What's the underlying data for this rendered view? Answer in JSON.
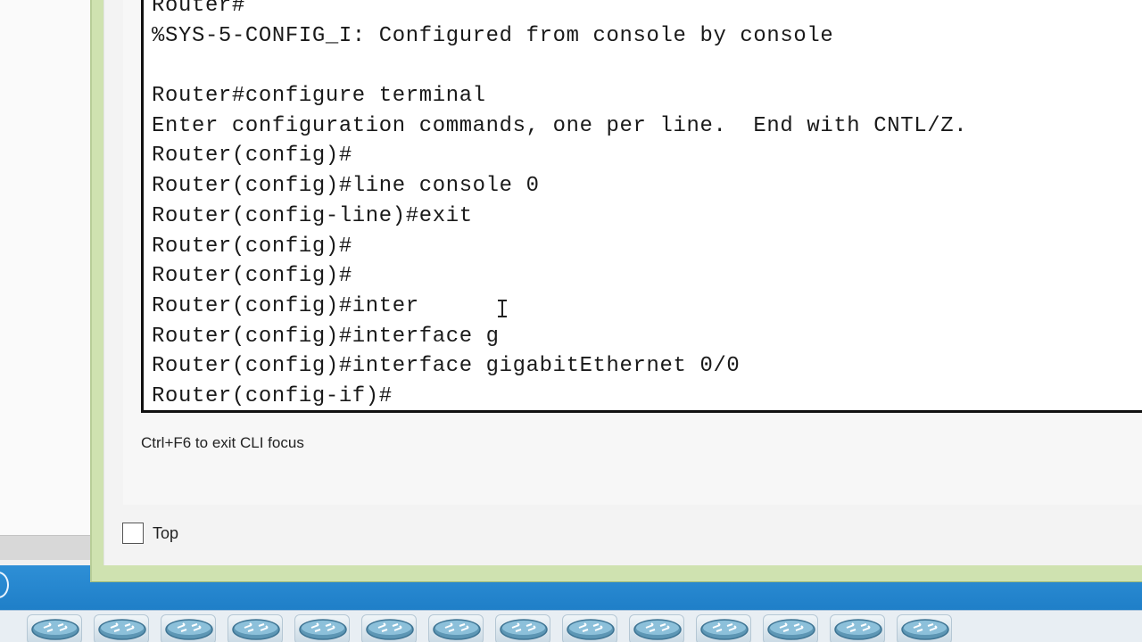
{
  "terminal": {
    "lines": [
      "Router#",
      "%SYS-5-CONFIG_I: Configured from console by console",
      "",
      "Router#configure terminal",
      "Enter configuration commands, one per line.  End with CNTL/Z.",
      "Router(config)#",
      "Router(config)#line console 0",
      "Router(config-line)#exit",
      "Router(config)#",
      "Router(config)#",
      "Router(config)#inter",
      "Router(config)#interface g",
      "Router(config)#interface gigabitEthernet 0/0",
      "Router(config-if)#"
    ]
  },
  "cli": {
    "hint": "Ctrl+F6 to exit CLI focus"
  },
  "top_checkbox": {
    "label": "Top",
    "checked": false
  },
  "device_palette": {
    "items": [
      {
        "icon": "router-icon"
      },
      {
        "icon": "router-icon"
      },
      {
        "icon": "router-icon"
      },
      {
        "icon": "router-icon"
      },
      {
        "icon": "router-icon"
      },
      {
        "icon": "router-icon"
      },
      {
        "icon": "router-icon"
      },
      {
        "icon": "router-icon"
      },
      {
        "icon": "router-icon"
      },
      {
        "icon": "router-icon"
      },
      {
        "icon": "router-icon"
      },
      {
        "icon": "router-icon"
      },
      {
        "icon": "router-icon"
      },
      {
        "icon": "router-icon"
      }
    ]
  },
  "colors": {
    "window_frame": "#cfe2b0",
    "taskbar": "#2e8fd6"
  }
}
